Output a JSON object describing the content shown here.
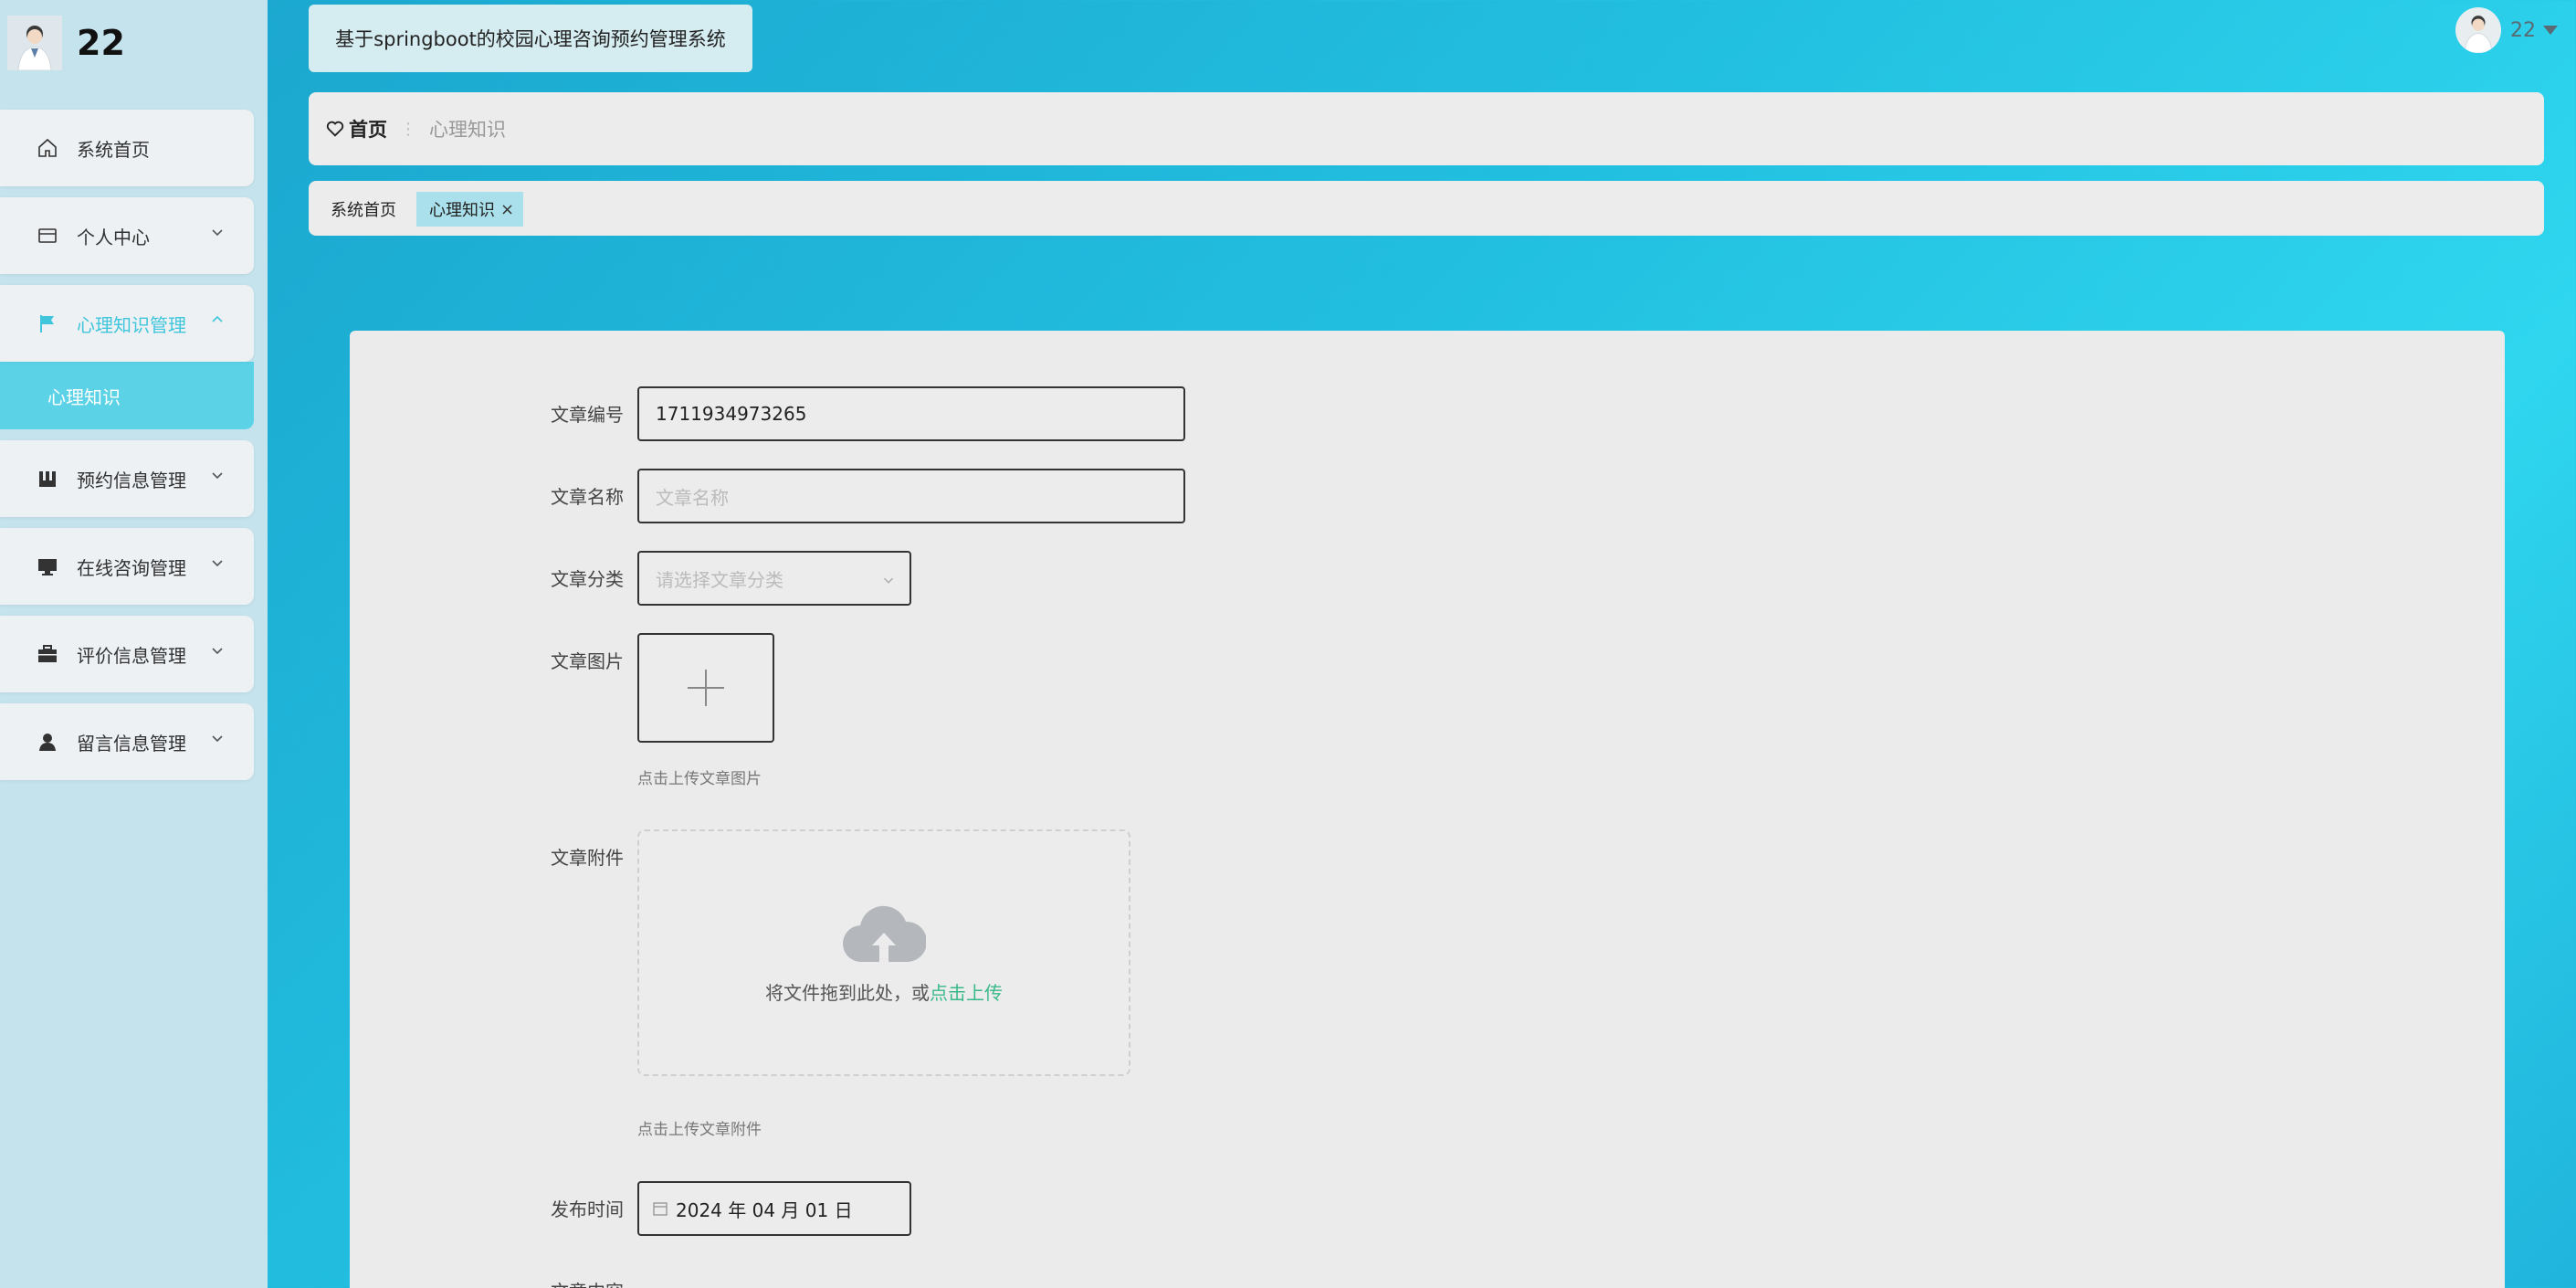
{
  "sidebar": {
    "user_title": "22",
    "menu": [
      {
        "label": "系统首页",
        "icon": "home-icon"
      },
      {
        "label": "个人中心",
        "icon": "wallet-icon"
      },
      {
        "label": "心理知识管理",
        "icon": "flag-icon"
      },
      {
        "label": "预约信息管理",
        "icon": "calendar-icon"
      },
      {
        "label": "在线咨询管理",
        "icon": "monitor-icon"
      },
      {
        "label": "评价信息管理",
        "icon": "briefcase-icon"
      },
      {
        "label": "留言信息管理",
        "icon": "user-icon"
      }
    ],
    "submenu": {
      "label": "心理知识"
    }
  },
  "header": {
    "app_title": "基于springboot的校园心理咨询预约管理系统",
    "user_name": "22"
  },
  "breadcrumb": {
    "home": "首页",
    "separator": "⋮",
    "current": "心理知识"
  },
  "tabs": [
    {
      "label": "系统首页"
    },
    {
      "label": "心理知识",
      "close": "×"
    }
  ],
  "form": {
    "article_no": {
      "label": "文章编号",
      "value": "1711934973265"
    },
    "article_name": {
      "label": "文章名称",
      "placeholder": "文章名称"
    },
    "article_category": {
      "label": "文章分类",
      "placeholder": "请选择文章分类"
    },
    "article_image": {
      "label": "文章图片",
      "hint": "点击上传文章图片"
    },
    "article_attachment": {
      "label": "文章附件",
      "drop_text": "将文件拖到此处，或",
      "drop_link": "点击上传",
      "hint": "点击上传文章附件"
    },
    "publish_time": {
      "label": "发布时间",
      "value": "2024 年 04 月 01 日"
    },
    "article_content": {
      "label": "文章内容"
    }
  },
  "colors": {
    "accent": "#3fc5dc",
    "submenu_bg": "#5bd2e6",
    "link": "#39b98a"
  }
}
